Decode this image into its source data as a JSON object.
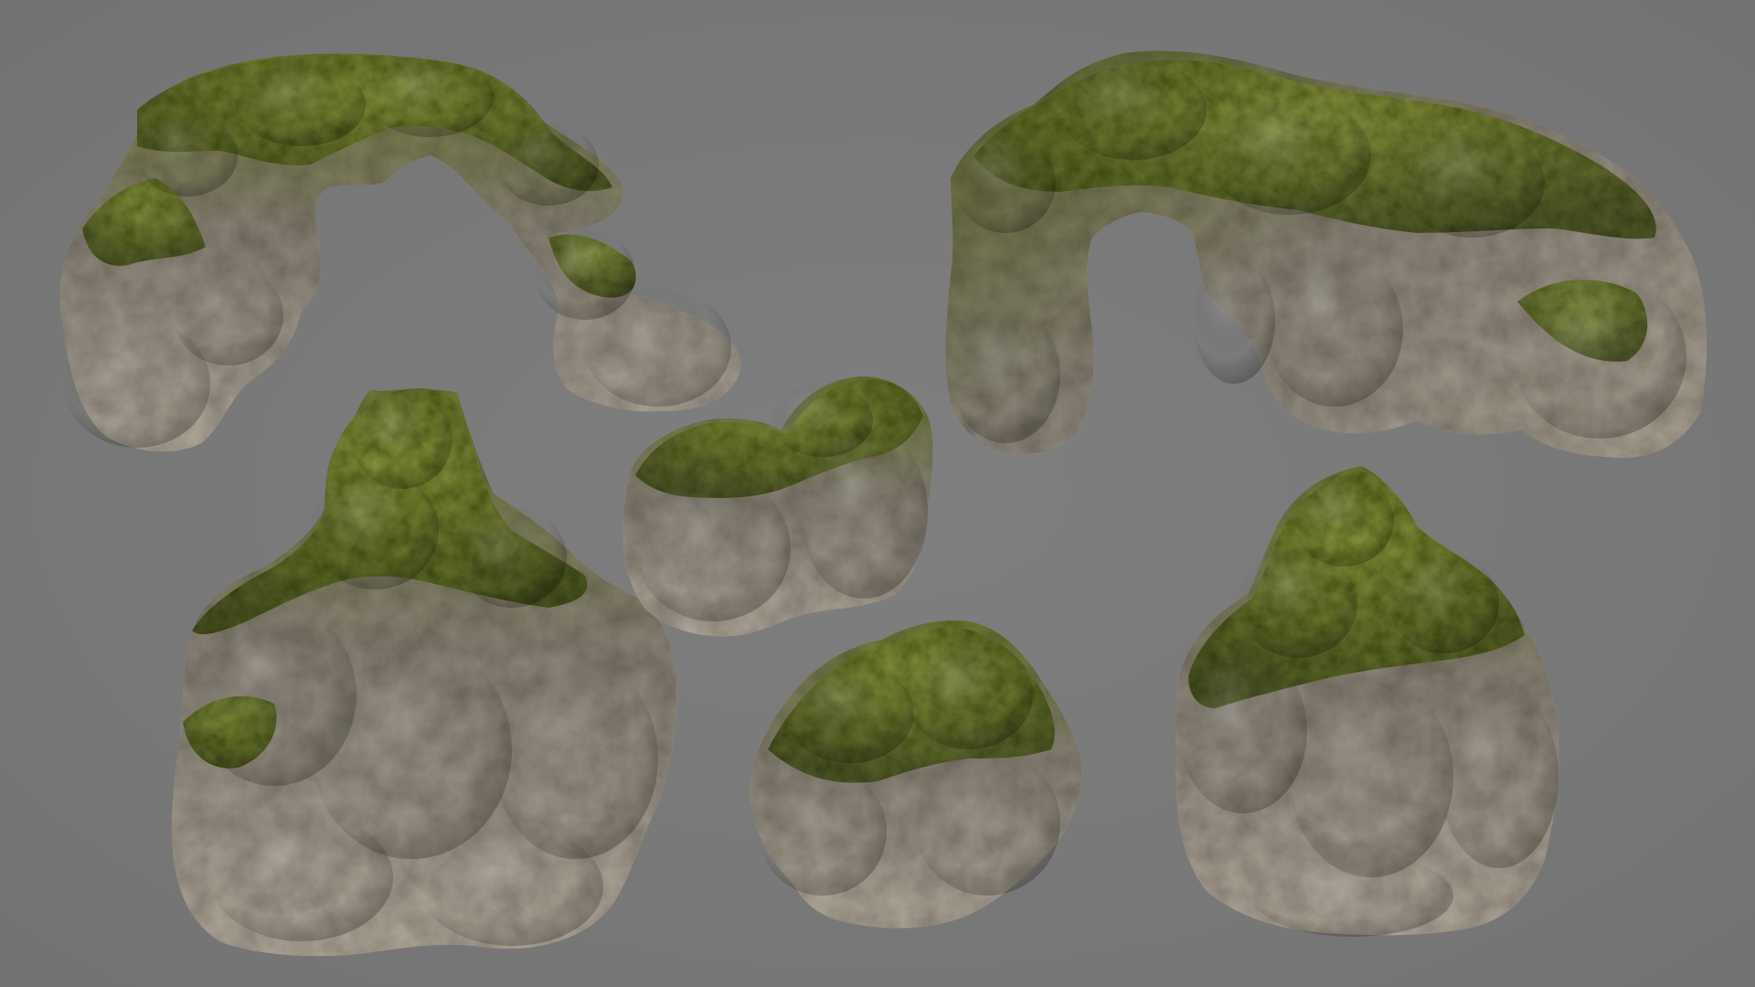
{
  "scene": {
    "description_visible_text": "",
    "background_color": "#7a7a7a",
    "palette": {
      "moss_dark": "#4f5a1f",
      "moss_mid": "#6d7a2c",
      "moss_light": "#8a9536",
      "rock_light": "#b8b0a3",
      "rock_mid": "#8f897f",
      "rock_dark": "#5e5a53",
      "shadow": "#3f3d39"
    },
    "assets": [
      {
        "name": "rock-arch-small"
      },
      {
        "name": "rock-arch-large"
      },
      {
        "name": "rock-pillar-cluster"
      },
      {
        "name": "rock-boulder-double"
      },
      {
        "name": "rock-boulder-low"
      },
      {
        "name": "rock-pillar-stacked"
      }
    ]
  }
}
